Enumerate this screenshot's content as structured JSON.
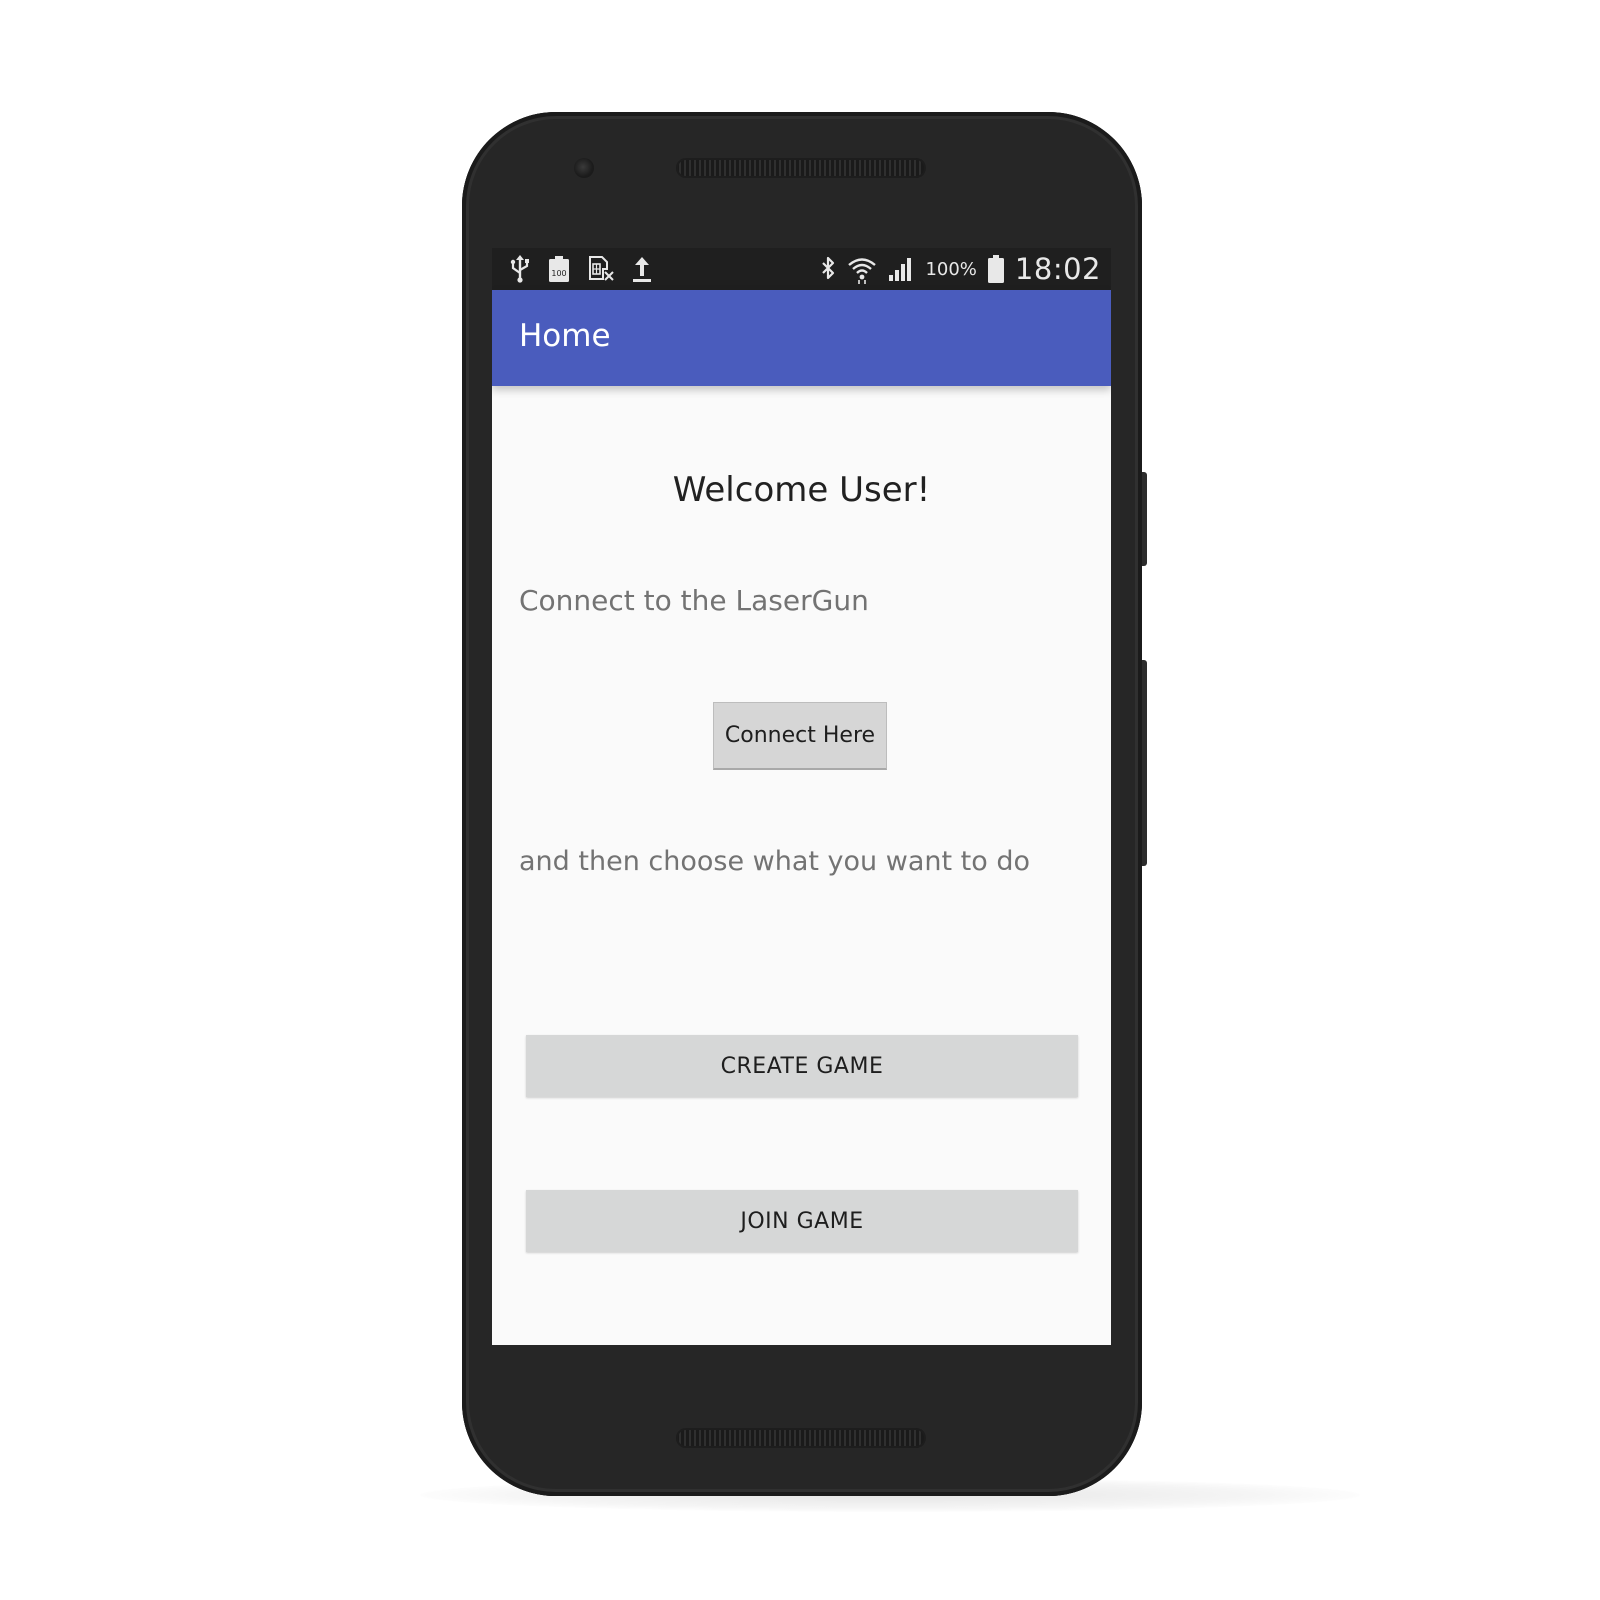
{
  "status_bar": {
    "left_icons": [
      "usb-icon",
      "battery-100-icon",
      "no-sim-icon",
      "upload-icon"
    ],
    "right_icons": [
      "bluetooth-icon",
      "wifi-icon",
      "cell-signal-icon",
      "battery-icon"
    ],
    "battery_percent": "100%",
    "time": "18:02",
    "mini_battery_label": "100"
  },
  "app_bar": {
    "title": "Home",
    "color": "#4a5cbd"
  },
  "main": {
    "welcome": "Welcome User!",
    "connect_prompt": "Connect to the LaserGun",
    "connect_button": "Connect Here",
    "choose_prompt": "and then choose what you want to do",
    "create_game_button": "CREATE GAME",
    "join_game_button": "JOIN GAME"
  },
  "colors": {
    "background": "#fafafa",
    "button": "#d6d7d7",
    "body_text": "#737373"
  }
}
